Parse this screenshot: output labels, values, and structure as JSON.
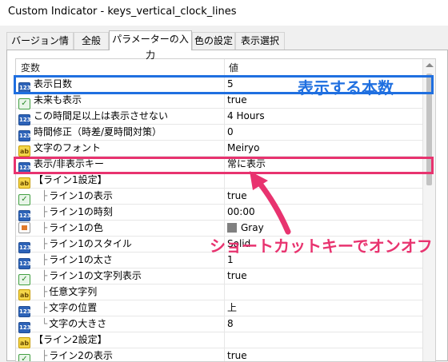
{
  "window": {
    "title": "Custom Indicator - keys_vertical_clock_lines"
  },
  "tabs": [
    {
      "label": "バージョン情報"
    },
    {
      "label": "全般"
    },
    {
      "label": "パラメーターの入力"
    },
    {
      "label": "色の設定"
    },
    {
      "label": "表示選択"
    }
  ],
  "table": {
    "col_name": "変数",
    "col_value": "値",
    "rows": [
      {
        "icon": "number-icon",
        "name": "表示日数",
        "value": "5"
      },
      {
        "icon": "bool-icon",
        "name": "未来も表示",
        "value": "true"
      },
      {
        "icon": "number-icon",
        "name": "この時間足以上は表示させない",
        "value": "4 Hours"
      },
      {
        "icon": "number-icon",
        "name": "時間修正（時差/夏時間対策）",
        "value": "0"
      },
      {
        "icon": "string-icon",
        "name": "文字のフォント",
        "value": "Meiryo"
      },
      {
        "icon": "number-icon",
        "name": "表示/非表示キー",
        "value": "常に表示"
      },
      {
        "icon": "string-icon",
        "name": "【ライン1設定】",
        "value": ""
      },
      {
        "icon": "bool-icon",
        "name": "ライン1の表示",
        "value": "true",
        "indent": "├"
      },
      {
        "icon": "number-icon",
        "name": "ライン1の時刻",
        "value": "00:00",
        "indent": "├"
      },
      {
        "icon": "color-icon",
        "name": "ライン1の色",
        "value": "Gray",
        "indent": "├"
      },
      {
        "icon": "number-icon",
        "name": "ライン1のスタイル",
        "value": "Solid",
        "indent": "├"
      },
      {
        "icon": "number-icon",
        "name": "ライン1の太さ",
        "value": "1",
        "indent": "├"
      },
      {
        "icon": "bool-icon",
        "name": "ライン1の文字列表示",
        "value": "true",
        "indent": "├"
      },
      {
        "icon": "string-icon",
        "name": "任意文字列",
        "value": "",
        "indent": "├"
      },
      {
        "icon": "number-icon",
        "name": "文字の位置",
        "value": "上",
        "indent": "├"
      },
      {
        "icon": "number-icon",
        "name": "文字の大きさ",
        "value": "8",
        "indent": "└"
      },
      {
        "icon": "string-icon",
        "name": "【ライン2設定】",
        "value": ""
      },
      {
        "icon": "bool-icon",
        "name": "ライン2の表示",
        "value": "true",
        "indent": "├"
      }
    ]
  },
  "annotations": {
    "blue_label": "表示する本数",
    "pink_label": "ショートカットキーでオンオフ",
    "blue_color": "#1f6fe0",
    "pink_color": "#e8336f"
  },
  "icon_text": {
    "number": "123",
    "bool": "✓",
    "string": "ab"
  }
}
